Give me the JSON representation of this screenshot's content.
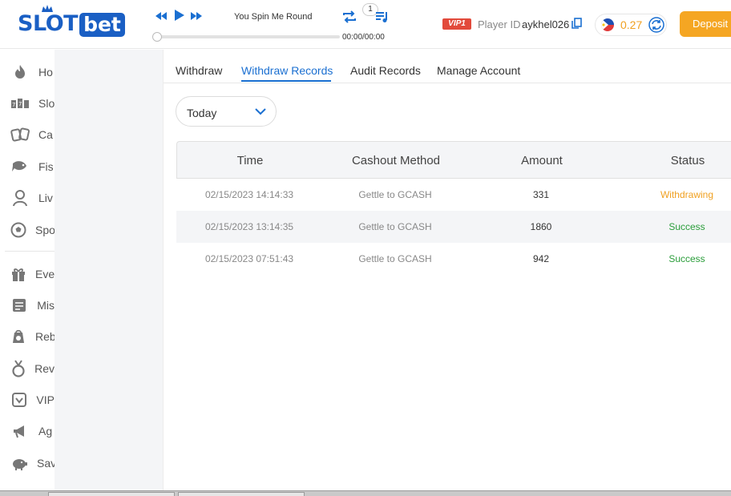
{
  "header": {
    "logo_text_a": "SLOT",
    "logo_text_b": "bet",
    "player": {
      "song": "You Spin Me Round",
      "playlist_count": "1",
      "time": "00:00/00:00",
      "progress": 0
    },
    "vip_label": "VIP1",
    "player_id_label": "Player ID",
    "player_id_value": "aykhel026",
    "balance": "0.27",
    "deposit_label": "Deposit"
  },
  "sidebar": {
    "items": [
      {
        "label": "Ho",
        "icon": "fire-icon"
      },
      {
        "label": "Slo",
        "icon": "slot-icon"
      },
      {
        "label": "Ca",
        "icon": "cards-icon"
      },
      {
        "label": "Fis",
        "icon": "fish-icon"
      },
      {
        "label": "Liv",
        "icon": "live-dealer-icon"
      },
      {
        "label": "Spo",
        "icon": "soccer-ball-icon"
      },
      {
        "label": "Eve",
        "icon": "gift-icon"
      },
      {
        "label": "Mis",
        "icon": "checklist-icon"
      },
      {
        "label": "Reb",
        "icon": "rebate-icon"
      },
      {
        "label": "Rev",
        "icon": "medal-icon"
      },
      {
        "label": "VIP",
        "icon": "vip-shield-icon"
      },
      {
        "label": "Ag",
        "icon": "megaphone-icon"
      },
      {
        "label": "Sav",
        "icon": "piggy-bank-icon"
      }
    ]
  },
  "tabs": [
    {
      "label": "Withdraw"
    },
    {
      "label": "Withdraw Records"
    },
    {
      "label": "Audit Records"
    },
    {
      "label": "Manage Account"
    }
  ],
  "filter": {
    "selected": "Today"
  },
  "table": {
    "headers": [
      "Time",
      "Cashout Method",
      "Amount",
      "Status"
    ],
    "rows": [
      {
        "time": "02/15/2023 14:14:33",
        "method": "Gettle to GCASH",
        "amount": "331",
        "status": "Withdrawing"
      },
      {
        "time": "02/15/2023 13:14:35",
        "method": "Gettle to GCASH",
        "amount": "1860",
        "status": "Success"
      },
      {
        "time": "02/15/2023 07:51:43",
        "method": "Gettle to GCASH",
        "amount": "942",
        "status": "Success"
      }
    ]
  },
  "colors": {
    "brand_blue": "#1a5fc4",
    "accent_blue": "#1a6fd1",
    "deposit_orange": "#f5a623",
    "status_pending": "#f0a020",
    "status_success": "#2a9d3a",
    "vip_red": "#e24a3b"
  }
}
